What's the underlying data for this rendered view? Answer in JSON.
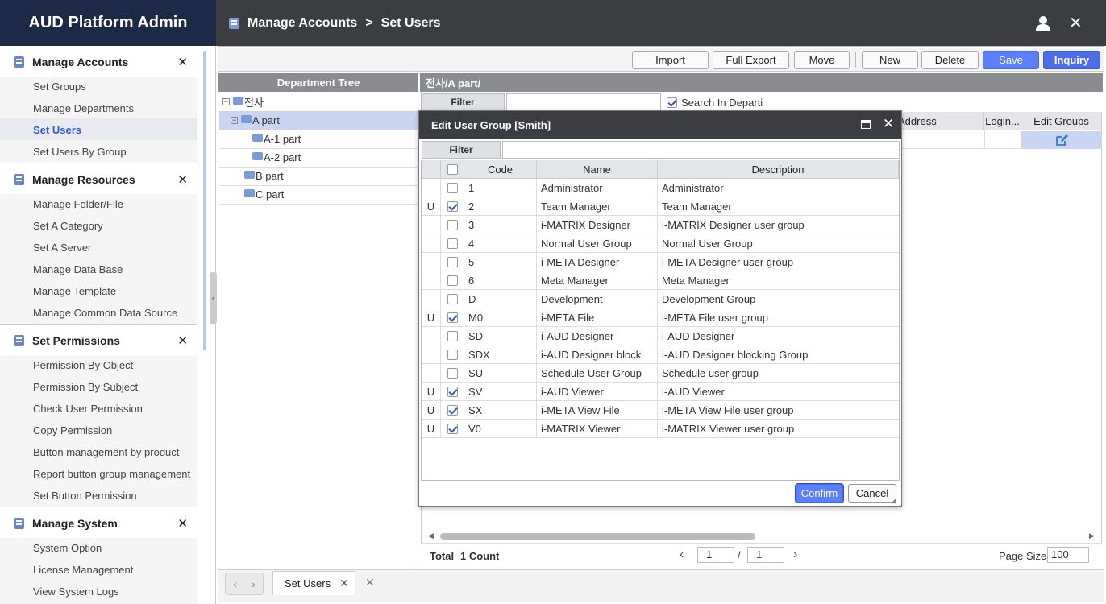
{
  "app": {
    "title": "AUD Platform Admin"
  },
  "breadcrumb": {
    "section": "Manage Accounts",
    "separator": ">",
    "page": "Set Users"
  },
  "sidebar": {
    "sections": [
      {
        "title": "Manage Accounts",
        "items": [
          "Set Groups",
          "Manage Departments",
          "Set Users",
          "Set Users By Group"
        ],
        "selected": "Set Users"
      },
      {
        "title": "Manage Resources",
        "items": [
          "Manage Folder/File",
          "Set A Category",
          "Set A Server",
          "Manage Data Base",
          "Manage Template",
          "Manage Common Data Source"
        ]
      },
      {
        "title": "Set Permissions",
        "items": [
          "Permission By Object",
          "Permission By Subject",
          "Check User Permission",
          "Copy Permission",
          "Button management by product",
          "Report button group management",
          "Set Button Permission"
        ]
      },
      {
        "title": "Manage System",
        "items": [
          "System Option",
          "License Management",
          "View System Logs"
        ]
      }
    ]
  },
  "toolbar": {
    "import": "Import",
    "full_export": "Full Export",
    "move": "Move",
    "new": "New",
    "delete": "Delete",
    "save": "Save",
    "inquiry": "Inquiry"
  },
  "dept_tree": {
    "header": "Department Tree",
    "nodes": [
      {
        "label": "전사",
        "expanded": true
      },
      {
        "label": "A part",
        "expanded": true,
        "selected": true
      },
      {
        "label": "A-1 part"
      },
      {
        "label": "A-2 part"
      },
      {
        "label": "B part"
      },
      {
        "label": "C part"
      }
    ]
  },
  "right_panel": {
    "path": "전사/A part/",
    "filter_label": "Filter",
    "filter_value": "",
    "search_in_dept_label": "Search In Departi",
    "search_in_dept_checked": true,
    "columns": {
      "address": "Address",
      "login": "Login...",
      "edit_groups": "Edit Groups"
    },
    "footer": {
      "total_label": "Total",
      "count": "1 Count",
      "page_current": "1",
      "page_sep": "/",
      "page_total": "1",
      "page_size_label": "Page Size",
      "page_size": "100"
    }
  },
  "dialog": {
    "title": "Edit User Group [Smith]",
    "filter_label": "Filter",
    "filter_value": "",
    "columns": {
      "code": "Code",
      "name": "Name",
      "description": "Description"
    },
    "rows": [
      {
        "flag": "",
        "checked": false,
        "code": "1",
        "name": "Administrator",
        "description": "Administrator"
      },
      {
        "flag": "U",
        "checked": true,
        "code": "2",
        "name": "Team Manager",
        "description": "Team Manager"
      },
      {
        "flag": "",
        "checked": false,
        "code": "3",
        "name": "i-MATRIX Designer",
        "description": "i-MATRIX Designer user group"
      },
      {
        "flag": "",
        "checked": false,
        "code": "4",
        "name": "Normal User Group",
        "description": "Normal User Group"
      },
      {
        "flag": "",
        "checked": false,
        "code": "5",
        "name": "i-META Designer",
        "description": "i-META Designer user group"
      },
      {
        "flag": "",
        "checked": false,
        "code": "6",
        "name": "Meta Manager",
        "description": "Meta Manager"
      },
      {
        "flag": "",
        "checked": false,
        "code": "D",
        "name": "Development",
        "description": "Development Group"
      },
      {
        "flag": "U",
        "checked": true,
        "code": "M0",
        "name": "i-META File",
        "description": "i-META File user group"
      },
      {
        "flag": "",
        "checked": false,
        "code": "SD",
        "name": "i-AUD Designer",
        "description": "i-AUD Designer"
      },
      {
        "flag": "",
        "checked": false,
        "code": "SDX",
        "name": "i-AUD Designer block",
        "description": "i-AUD Designer blocking Group"
      },
      {
        "flag": "",
        "checked": false,
        "code": "SU",
        "name": "Schedule User Group",
        "description": "Schedule user group"
      },
      {
        "flag": "U",
        "checked": true,
        "code": "SV",
        "name": "i-AUD Viewer",
        "description": "i-AUD Viewer"
      },
      {
        "flag": "U",
        "checked": true,
        "code": "SX",
        "name": "i-META View File",
        "description": "i-META View File user group"
      },
      {
        "flag": "U",
        "checked": true,
        "code": "V0",
        "name": "i-MATRIX Viewer",
        "description": "i-MATRIX Viewer user group"
      }
    ],
    "confirm": "Confirm",
    "cancel": "Cancel"
  },
  "tabs": [
    {
      "label": "Set Users"
    }
  ],
  "icons": {
    "close": "close-icon",
    "user": "user-icon",
    "maximize": "maximize-icon",
    "edit": "edit-icon"
  },
  "colors": {
    "brand_bg": "#1d2a47",
    "accent": "#5c7ffd",
    "selected_text": "#2f5bd0"
  }
}
